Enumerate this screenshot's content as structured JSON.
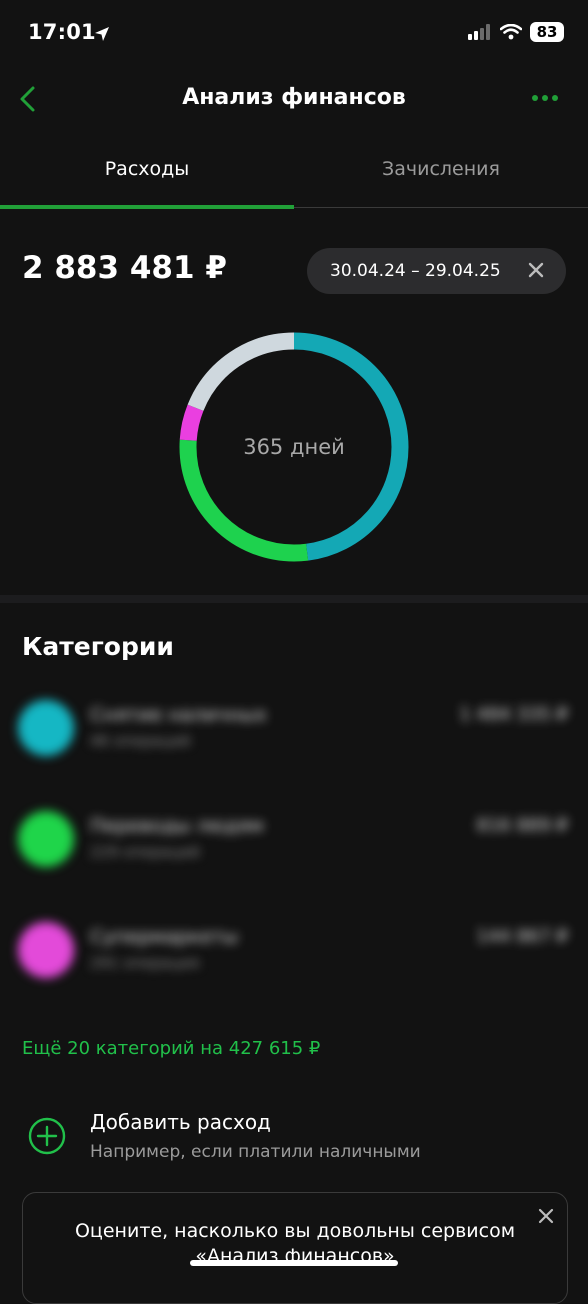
{
  "status_bar": {
    "time": "17:01",
    "battery": "83"
  },
  "header": {
    "title": "Анализ финансов"
  },
  "tabs": [
    {
      "label": "Расходы",
      "active": true
    },
    {
      "label": "Зачисления",
      "active": false
    }
  ],
  "summary": {
    "total": "2 883 481 ₽",
    "period": "30.04.24 – 29.04.25"
  },
  "chart_data": {
    "type": "pie",
    "center_label": "365 дней",
    "slices": [
      {
        "value": 0.48,
        "color": "#14a8b5"
      },
      {
        "value": 0.28,
        "color": "#1ed24e"
      },
      {
        "value": 0.05,
        "color": "#ea3fe0"
      },
      {
        "value": 0.19,
        "color": "#cfd8de"
      }
    ]
  },
  "categories": {
    "heading": "Категории",
    "items": [
      {
        "name": "Снятие наличных",
        "sub": "46 операций",
        "amount": "1 484 335 ₽",
        "color": "#15b7c4"
      },
      {
        "name": "Переводы людям",
        "sub": "229 операций",
        "amount": "816 889 ₽",
        "color": "#1fd54a"
      },
      {
        "name": "Супермаркеты",
        "sub": "291 операция",
        "amount": "144 867 ₽",
        "color": "#e34ad9"
      }
    ],
    "more_link": "Ещё 20 категорий на 427 615 ₽"
  },
  "add_expense": {
    "title": "Добавить расход",
    "subtitle": "Например, если платили наличными"
  },
  "feedback": {
    "text": "Оцените, насколько вы довольны сервисом «Анализ финансов»"
  },
  "colors": {
    "accent": "#21a038",
    "background": "#121212"
  }
}
